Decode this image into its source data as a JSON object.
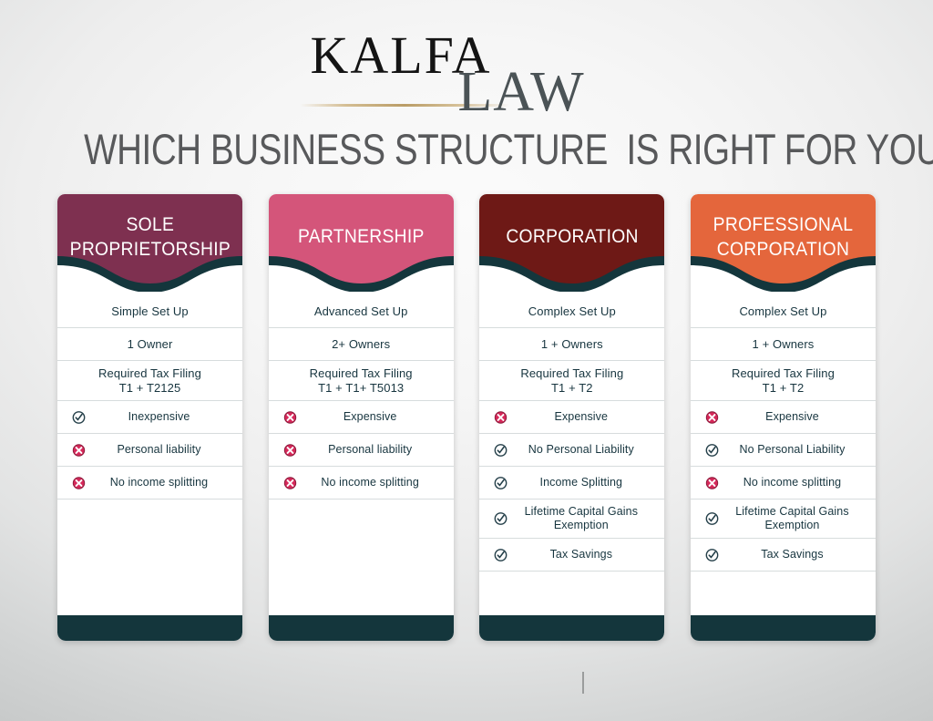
{
  "brand": {
    "name_primary": "KALFA",
    "name_secondary": "LAW"
  },
  "title": "WHICH BUSINESS STRUCTURE  IS RIGHT FOR YOU?",
  "colors": {
    "sole_proprietorship": "#7e3050",
    "partnership": "#d4557a",
    "corporation": "#6e1916",
    "professional_corporation": "#e4663c",
    "band": "#14363c",
    "footer": "#14363c",
    "text": "#17353f",
    "negative_icon": "#d6285a",
    "positive_icon": "#243f49",
    "title": "#58595b"
  },
  "columns": [
    {
      "id": "sole-proprietorship",
      "header": "SOLE\nPROPRIETORSHIP",
      "header_color": "#7e3050",
      "rows": [
        {
          "icon": "none",
          "text": "Simple Set Up"
        },
        {
          "icon": "none",
          "text": "1 Owner"
        },
        {
          "icon": "none",
          "text": "Required Tax Filing\nT1 + T2125"
        },
        {
          "icon": "check",
          "text": "Inexpensive"
        },
        {
          "icon": "cross",
          "text": "Personal liability"
        },
        {
          "icon": "cross",
          "text": "No income splitting"
        }
      ]
    },
    {
      "id": "partnership",
      "header": "PARTNERSHIP",
      "header_color": "#d4557a",
      "rows": [
        {
          "icon": "none",
          "text": "Advanced Set Up"
        },
        {
          "icon": "none",
          "text": "2+ Owners"
        },
        {
          "icon": "none",
          "text": "Required Tax Filing\nT1 + T1+ T5013"
        },
        {
          "icon": "cross",
          "text": "Expensive"
        },
        {
          "icon": "cross",
          "text": "Personal liability"
        },
        {
          "icon": "cross",
          "text": "No income splitting"
        }
      ]
    },
    {
      "id": "corporation",
      "header": "CORPORATION",
      "header_color": "#6e1916",
      "rows": [
        {
          "icon": "none",
          "text": "Complex Set Up"
        },
        {
          "icon": "none",
          "text": "1 + Owners"
        },
        {
          "icon": "none",
          "text": "Required Tax Filing\nT1 + T2"
        },
        {
          "icon": "cross",
          "text": "Expensive"
        },
        {
          "icon": "check",
          "text": "No Personal Liability"
        },
        {
          "icon": "check",
          "text": "Income Splitting"
        },
        {
          "icon": "check",
          "text": "Lifetime Capital Gains\nExemption"
        },
        {
          "icon": "check",
          "text": "Tax Savings"
        }
      ]
    },
    {
      "id": "professional-corporation",
      "header": "PROFESSIONAL\nCORPORATION",
      "header_color": "#e4663c",
      "rows": [
        {
          "icon": "none",
          "text": "Complex Set Up"
        },
        {
          "icon": "none",
          "text": "1 + Owners"
        },
        {
          "icon": "none",
          "text": "Required Tax Filing\nT1 + T2"
        },
        {
          "icon": "cross",
          "text": "Expensive"
        },
        {
          "icon": "check",
          "text": "No Personal Liability"
        },
        {
          "icon": "cross",
          "text": "No income splitting"
        },
        {
          "icon": "check",
          "text": "Lifetime Capital Gains\nExemption"
        },
        {
          "icon": "check",
          "text": "Tax Savings"
        }
      ]
    }
  ]
}
